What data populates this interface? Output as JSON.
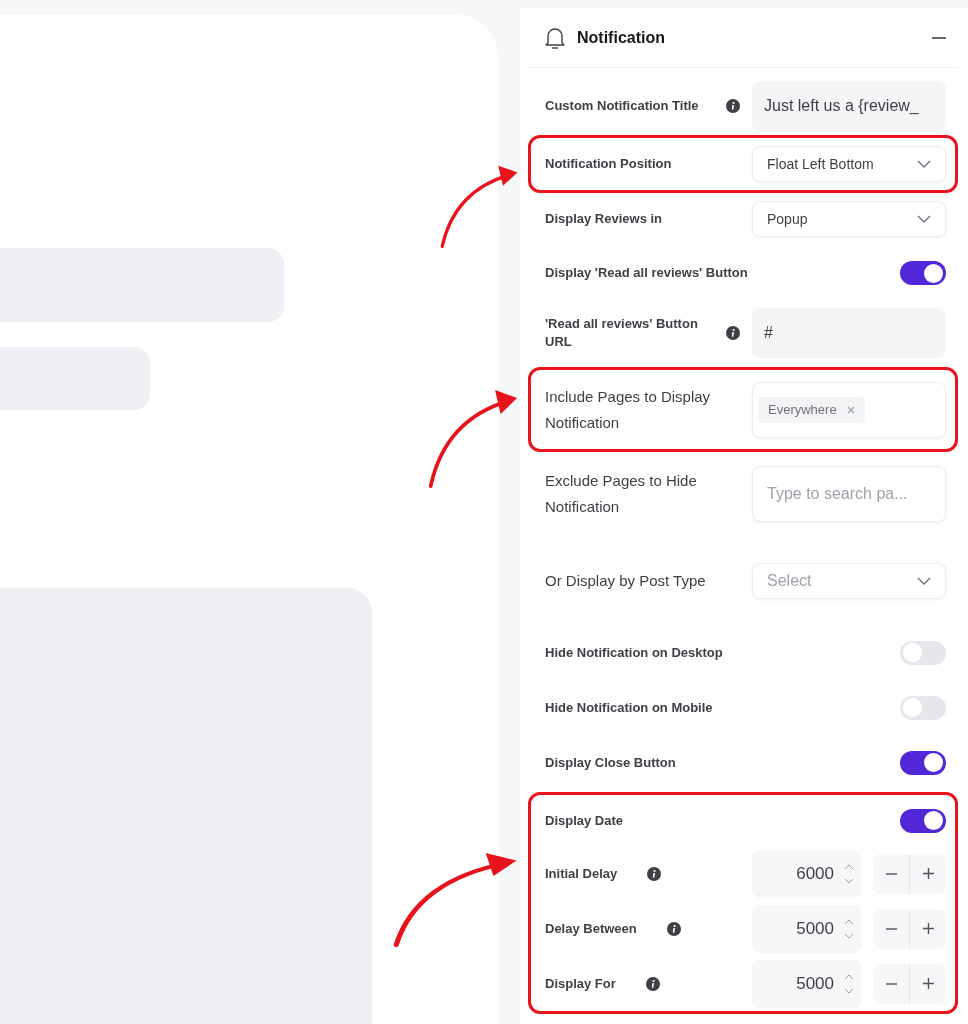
{
  "panel": {
    "title": "Notification",
    "expanded": true
  },
  "sections": [
    {
      "highlighted": false,
      "fields": [
        {
          "kind": "text",
          "label": "Custom Notification Title",
          "info": true,
          "value": "Just left us a {review_"
        }
      ]
    },
    {
      "highlighted": true,
      "fields": [
        {
          "kind": "select",
          "label": "Notification Position",
          "info": false,
          "value": "Float Left Bottom"
        }
      ]
    },
    {
      "highlighted": false,
      "fields": [
        {
          "kind": "select",
          "label": "Display Reviews in",
          "info": false,
          "value": "Popup"
        },
        {
          "kind": "toggle",
          "label": "Display 'Read all reviews' Button",
          "info": false,
          "on": true
        },
        {
          "kind": "text",
          "label": "'Read all reviews' Button URL",
          "info": true,
          "value": "#"
        }
      ]
    },
    {
      "highlighted": true,
      "fields": [
        {
          "kind": "tags",
          "label": "Include Pages to Display Notification",
          "info": false,
          "tags": [
            "Everywhere"
          ]
        }
      ]
    },
    {
      "highlighted": false,
      "fields": [
        {
          "kind": "search",
          "label": "Exclude Pages to Hide Notification",
          "info": false,
          "placeholder": "Type to search pa..."
        },
        {
          "kind": "select",
          "label": "Or Display by Post Type",
          "info": false,
          "placeholder": "Select"
        },
        {
          "kind": "toggle",
          "label": "Hide Notification on Desktop",
          "info": false,
          "on": false
        },
        {
          "kind": "toggle",
          "label": "Hide Notification on Mobile",
          "info": false,
          "on": false
        },
        {
          "kind": "toggle",
          "label": "Display Close Button",
          "info": false,
          "on": true
        }
      ]
    },
    {
      "highlighted": true,
      "fields": [
        {
          "kind": "toggle",
          "label": "Display Date",
          "info": false,
          "on": true
        },
        {
          "kind": "number",
          "label": "Initial Delay",
          "info": true,
          "value": "6000"
        },
        {
          "kind": "number",
          "label": "Delay Between",
          "info": true,
          "value": "5000"
        },
        {
          "kind": "number",
          "label": "Display For",
          "info": true,
          "value": "5000"
        }
      ]
    }
  ]
}
